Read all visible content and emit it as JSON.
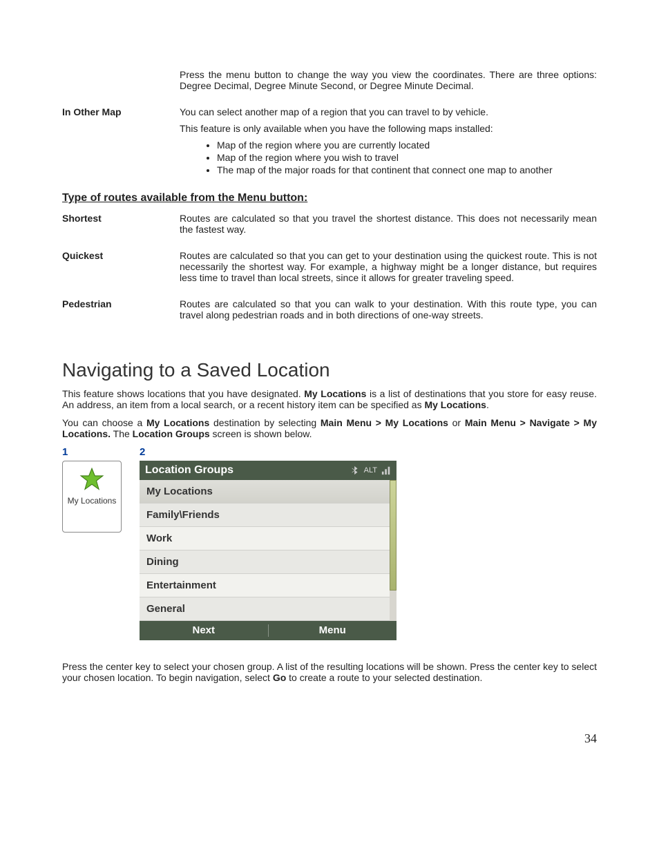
{
  "intro_coords": "Press the menu button to change the way you view the coordinates. There are three options: Degree Decimal, Degree Minute Second, or Degree Minute Decimal.",
  "in_other_map": {
    "term": "In Other Map",
    "p1": "You can select another map of a region that you can travel to by vehicle.",
    "p2": "This feature is only available when you have the following maps installed:",
    "bullets": [
      "Map of the region where you are currently located",
      "Map of the region where you wish to travel",
      "The map of the major roads for that continent that connect one map to another"
    ]
  },
  "routes_section_title": "Type of routes available from the Menu button:",
  "routes": {
    "shortest": {
      "term": "Shortest",
      "desc": "Routes are calculated so that you travel the shortest distance. This does not necessarily mean the fastest way."
    },
    "quickest": {
      "term": "Quickest",
      "desc": "Routes are calculated so that you can get to your destination using the quickest route. This is not necessarily the shortest way.  For example, a highway might be a longer distance, but requires less time to travel than local streets, since it allows for greater traveling speed."
    },
    "pedestrian": {
      "term": "Pedestrian",
      "desc": "Routes are calculated so that you can walk to your destination. With this route type, you can travel along pedestrian roads and in both directions of one-way streets."
    }
  },
  "nav_heading": "Navigating to a Saved Location",
  "nav_p1_pre": "This feature shows locations that you have designated. ",
  "nav_p1_bold1": "My Locations",
  "nav_p1_mid": " is a list of destinations that you store for easy reuse. An address, an item from a local search, or a recent history item can be specified as ",
  "nav_p1_bold2": "My Locations",
  "nav_p1_post": ".",
  "nav_p2_pre": "You can choose a ",
  "nav_p2_b1": "My Locations",
  "nav_p2_m1": " destination by selecting ",
  "nav_p2_b2": "Main Menu > My Locations",
  "nav_p2_m2": " or ",
  "nav_p2_b3": "Main Menu > Navigate > My Locations.",
  "nav_p2_m3": "  The ",
  "nav_p2_b4": "Location Groups",
  "nav_p2_end": " screen is shown below.",
  "fig": {
    "num1": "1",
    "num2": "2",
    "icon_label": "My Locations",
    "status_alt": "ALT",
    "device_title": "Location Groups",
    "rows": [
      "My Locations",
      "Family\\Friends",
      "Work",
      "Dining",
      "Entertainment",
      "General"
    ],
    "footer_next": "Next",
    "footer_menu": "Menu"
  },
  "closing_pre": "Press the center key to select your chosen group. A list of the resulting locations will be shown. Press the center key to select your chosen location. To begin navigation, select ",
  "closing_bold": "Go",
  "closing_post": " to create a route to your selected destination.",
  "page_number": "34"
}
